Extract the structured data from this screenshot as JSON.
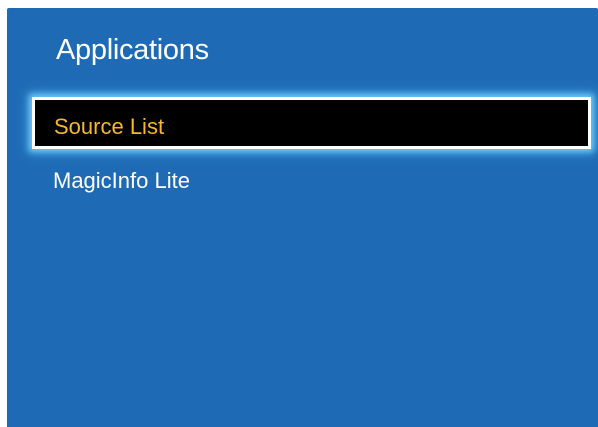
{
  "panel": {
    "title": "Applications"
  },
  "menu": {
    "items": [
      {
        "label": "Source List",
        "selected": true
      },
      {
        "label": "MagicInfo Lite",
        "selected": false
      }
    ]
  },
  "colors": {
    "panel_background": "#1f6ab4",
    "selected_background": "#000000",
    "selected_text": "#f5b82e",
    "normal_text": "#ffffff",
    "focus_glow": "#78d7ff"
  }
}
